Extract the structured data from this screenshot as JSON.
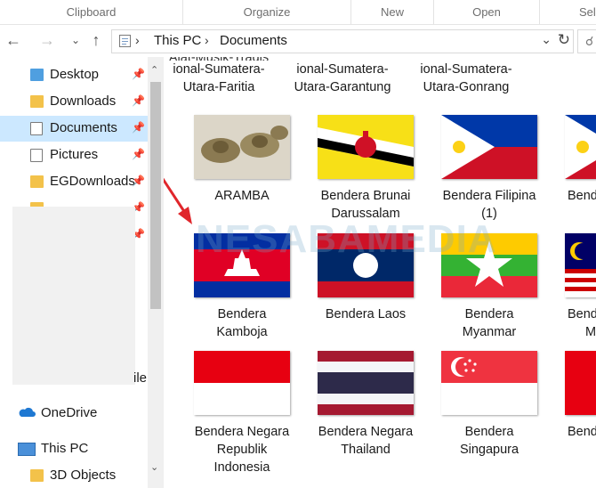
{
  "ribbon": {
    "groups": [
      "Clipboard",
      "Organize",
      "New",
      "Open",
      "Sel"
    ]
  },
  "address": {
    "crumbs": [
      "This PC",
      "Documents"
    ]
  },
  "navigation": {
    "items": [
      {
        "label": "Desktop",
        "pinned": true
      },
      {
        "label": "Downloads",
        "pinned": true
      },
      {
        "label": "Documents",
        "pinned": true,
        "selected": true
      },
      {
        "label": "Pictures",
        "pinned": true
      },
      {
        "label": "EGDownloads",
        "pinned": true
      }
    ],
    "onedrive": "OneDrive",
    "this_pc": "This PC",
    "objects": "3D Objects",
    "partial_text": "ile"
  },
  "content": {
    "top_row_partial": [
      {
        "line1": "ional-Sumatera-",
        "line2": "Utara-Faritia"
      },
      {
        "line1": "ional-Sumatera-",
        "line2": "Utara-Garantung"
      },
      {
        "line1": "ional-Sumatera-",
        "line2": "Utara-Gonrang"
      }
    ],
    "watermark": "NESABAMEDIA",
    "files": [
      {
        "line1": "ARAMBA",
        "line2": ""
      },
      {
        "line1": "Bendera Brunai",
        "line2": "Darussalam"
      },
      {
        "line1": "Bendera Filipina",
        "line2": "(1)"
      },
      {
        "line1": "Bend",
        "line2": ""
      },
      {
        "line1": "Bendera",
        "line2": "Kamboja"
      },
      {
        "line1": "Bendera Laos",
        "line2": ""
      },
      {
        "line1": "Bendera",
        "line2": "Myanmar"
      },
      {
        "line1": "Bend",
        "line2": "M"
      },
      {
        "line1": "Bendera Negara",
        "line2": "Republik",
        "line3": "Indonesia"
      },
      {
        "line1": "Bendera Negara",
        "line2": "Thailand"
      },
      {
        "line1": "Bendera",
        "line2": "Singapura"
      },
      {
        "line1": "Bende",
        "line2": ""
      }
    ]
  },
  "colors": {
    "selection": "#cce8ff",
    "arrow": "#e0262b"
  }
}
